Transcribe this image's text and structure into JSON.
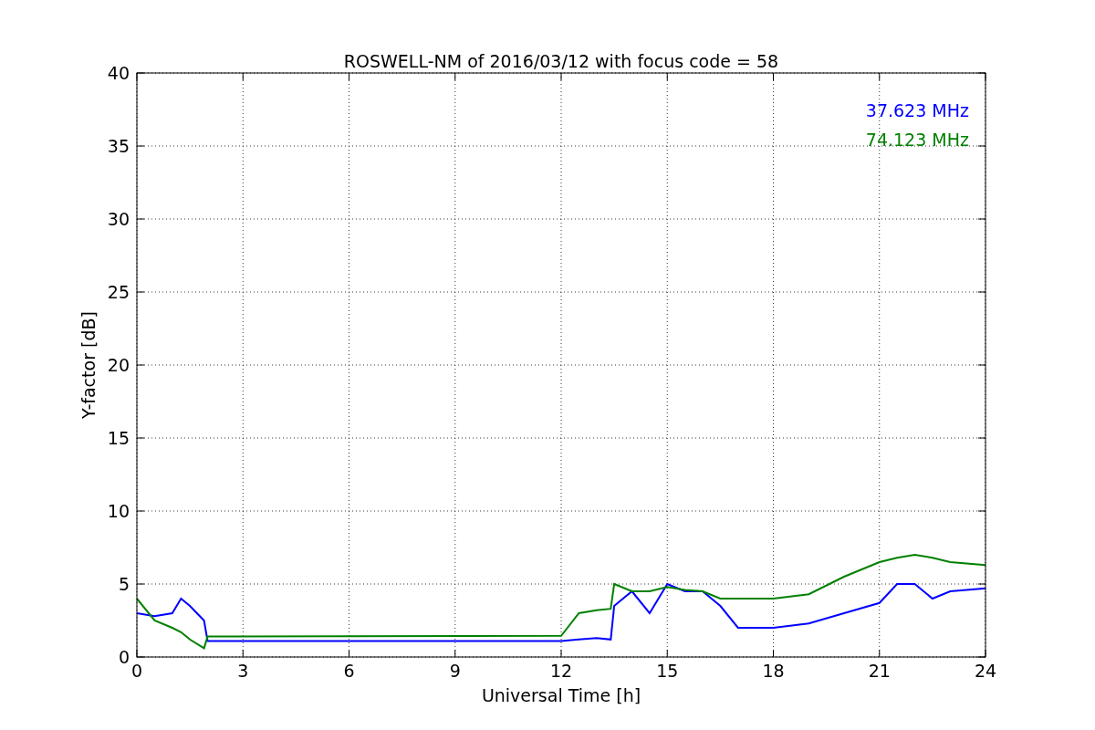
{
  "chart_data": {
    "type": "line",
    "title": "ROSWELL-NM of 2016/03/12 with focus code = 58",
    "xlabel": "Universal Time [h]",
    "ylabel": "Y-factor [dB]",
    "x": [
      0,
      0.5,
      1,
      1.25,
      1.5,
      1.9,
      2,
      12,
      12.5,
      13,
      13.4,
      13.5,
      14,
      14.5,
      15,
      15.5,
      16,
      16.5,
      17,
      18,
      19,
      20,
      21,
      21.5,
      22,
      22.5,
      23,
      24
    ],
    "series": [
      {
        "name": "37.623 MHz",
        "color": "#0000ff",
        "values": [
          3,
          2.8,
          3,
          4,
          3.5,
          2.5,
          1.1,
          1.1,
          1.2,
          1.3,
          1.2,
          3.5,
          4.5,
          3,
          5,
          4.5,
          4.5,
          3.5,
          2,
          2,
          2.3,
          3,
          3.7,
          5,
          5,
          4,
          4.5,
          4.7
        ]
      },
      {
        "name": "74.123 MHz",
        "color": "#008000",
        "values": [
          4,
          2.5,
          2,
          1.7,
          1.2,
          0.6,
          1.4,
          1.45,
          3,
          3.2,
          3.3,
          5,
          4.5,
          4.5,
          4.8,
          4.6,
          4.5,
          4,
          4,
          4,
          4.3,
          5.5,
          6.5,
          6.8,
          7,
          6.8,
          6.5,
          6.3
        ]
      }
    ],
    "grid": true,
    "xlim": [
      0,
      24
    ],
    "ylim": [
      0,
      40
    ],
    "xticks": [
      0,
      3,
      6,
      9,
      12,
      15,
      18,
      21,
      24
    ],
    "yticks": [
      0,
      5,
      10,
      15,
      20,
      25,
      30,
      35,
      40
    ]
  }
}
